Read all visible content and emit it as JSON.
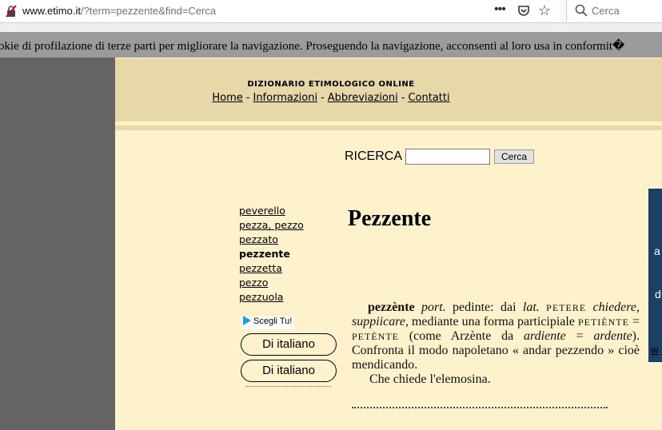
{
  "browser": {
    "url_host": "www.etimo.it",
    "url_path": "/?term=pezzente&find=Cerca",
    "search_placeholder": "Cerca"
  },
  "cookie_banner": {
    "text": "okie di profilazione di terze parti per migliorare la navigazione. Proseguendo la navigazione, acconsenti al loro usa in conformit�"
  },
  "header": {
    "title": "DIZIONARIO ETIMOLOGICO ONLINE",
    "nav": [
      {
        "label": "Home"
      },
      {
        "label": "Informazioni"
      },
      {
        "label": "Abbreviazioni"
      },
      {
        "label": "Contatti"
      }
    ]
  },
  "search": {
    "label": "RICERCA",
    "value": "",
    "button": "Cerca"
  },
  "word_list": [
    {
      "label": "peverello"
    },
    {
      "label": "pezza, pezzo"
    },
    {
      "label": "pezzato"
    },
    {
      "label": "pezzente",
      "current": true
    },
    {
      "label": "pezzetta"
    },
    {
      "label": "pezzo"
    },
    {
      "label": "pezzuola"
    }
  ],
  "ad": {
    "choice_label": "Scegli Tu!",
    "button1": "Di italiano",
    "button2": "Di italiano",
    "right_letter1": "a",
    "right_letter2": "d",
    "right_link": "w"
  },
  "entry": {
    "title": "Pezzente",
    "scan_head": "pezzènte",
    "scan_tag1": "port.",
    "scan_t1": " pedinte: dai ",
    "scan_tag2": "lat.",
    "scan_sc1": "PETERE",
    "scan_it1": "chiedere, suppiicare",
    "scan_t2": ", mediante una forma participiale ",
    "scan_sc2": "PETIÈNTE",
    "scan_t3": " = ",
    "scan_sc3": "PETÈNTE",
    "scan_t4": " (come Arzènte da ",
    "scan_it2": "ardiente",
    "scan_t5": " = ",
    "scan_it3": "ardente",
    "scan_t6": "). Confronta il modo napoletano « andar pezzendo » cioè mendicando.",
    "scan_line2": "Che chiede l'elemosina."
  }
}
